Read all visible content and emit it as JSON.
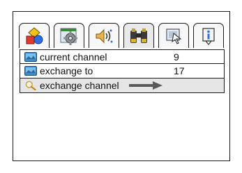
{
  "tabs": [
    {
      "icon": "shapes-icon"
    },
    {
      "icon": "settings-gear-icon"
    },
    {
      "icon": "speaker-icon"
    },
    {
      "icon": "binoculars-icon"
    },
    {
      "icon": "screen-icon"
    },
    {
      "icon": "info-icon"
    }
  ],
  "rows": [
    {
      "icon": "tv-screen-icon",
      "label": "current channel",
      "value": "9"
    },
    {
      "icon": "tv-screen-icon",
      "label": "exchange to",
      "value": "17"
    },
    {
      "icon": "magnifier-icon",
      "label": "exchange channel",
      "action_icon": "arrow-right-icon"
    }
  ],
  "colors": {
    "border": "#1a1a1a",
    "selected_row": "#e6e6e6",
    "arrow": "#5a5a5a"
  }
}
